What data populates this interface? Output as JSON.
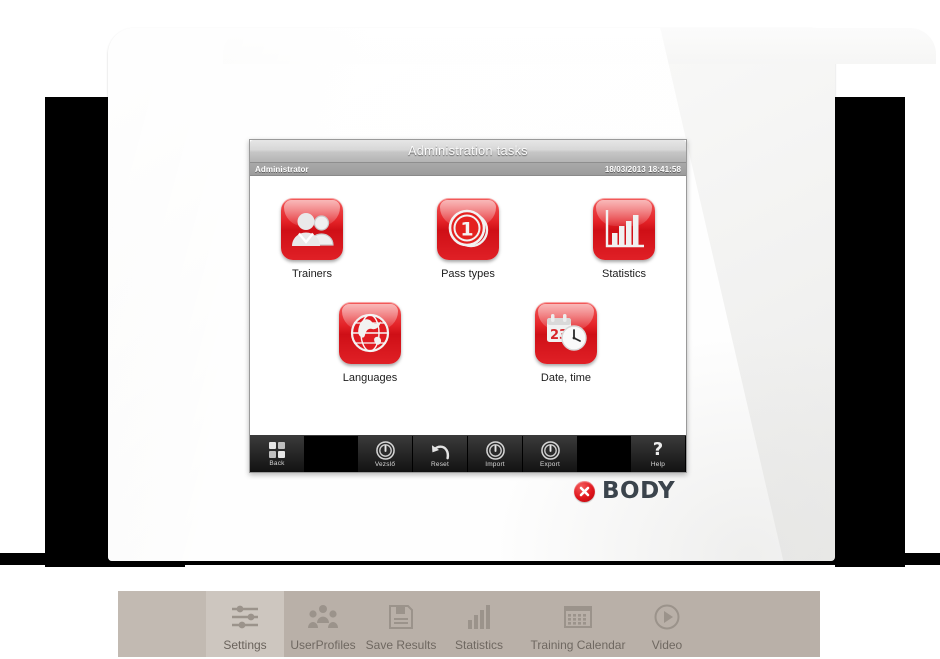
{
  "window": {
    "title": "Administration tasks",
    "user": "Administrator",
    "datetime": "18/03/2013 18:41:58"
  },
  "tiles": [
    {
      "label": "Trainers",
      "icon": "trainers-icon"
    },
    {
      "label": "Pass types",
      "icon": "pass-types-icon"
    },
    {
      "label": "Statistics",
      "icon": "statistics-icon"
    },
    {
      "label": "Languages",
      "icon": "languages-icon"
    },
    {
      "label": "Date, time",
      "icon": "date-time-icon"
    }
  ],
  "toolbar": [
    {
      "label": "Back",
      "icon": "grid-squares-icon"
    },
    {
      "label": "Vezslő",
      "icon": "power-icon"
    },
    {
      "label": "Reset",
      "icon": "undo-arrow-icon"
    },
    {
      "label": "Import",
      "icon": "power-icon"
    },
    {
      "label": "Export",
      "icon": "power-icon"
    },
    {
      "label": "Help",
      "icon": "question-mark-icon"
    }
  ],
  "logo": {
    "text": "BODY",
    "mark": "x-circle-icon"
  },
  "taskbar": [
    {
      "label": "Settings",
      "icon": "sliders-icon",
      "active": true
    },
    {
      "label": "UserProfiles",
      "icon": "people-icon",
      "active": false
    },
    {
      "label": "Save Results",
      "icon": "floppy-icon",
      "active": false
    },
    {
      "label": "Statistics",
      "icon": "bars-icon",
      "active": false
    },
    {
      "label": "Training Calendar",
      "icon": "calendar-icon",
      "active": false
    },
    {
      "label": "Video",
      "icon": "play-icon",
      "active": false
    }
  ],
  "colors": {
    "accent_red": "#e32227",
    "logo_text": "#3b444c",
    "taskbar_bg": "#b9b0a8",
    "taskbar_active": "#cdc6bf"
  }
}
